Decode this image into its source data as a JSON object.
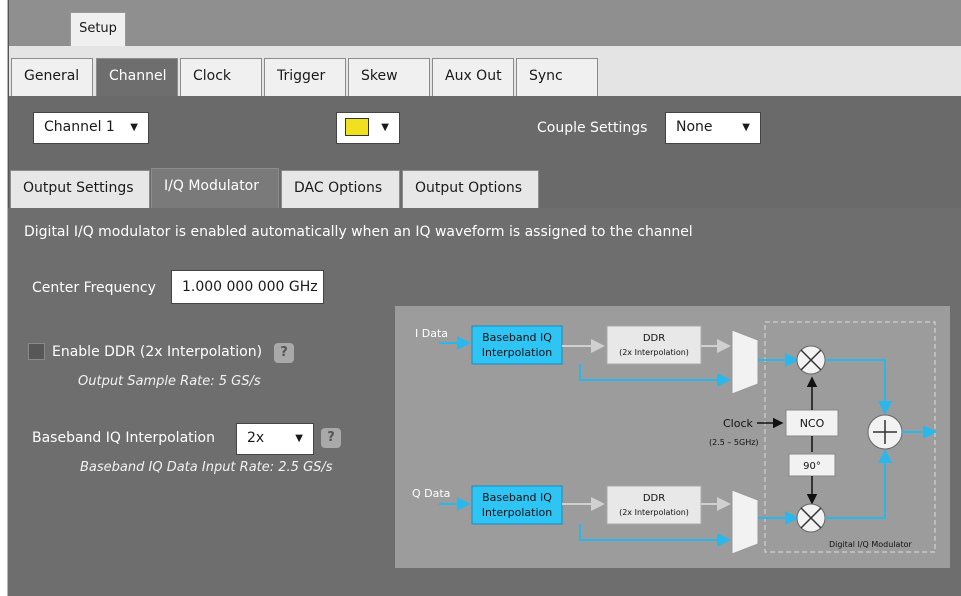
{
  "setup_tab": "Setup",
  "tabs": [
    "General",
    "Channel",
    "Clock",
    "Trigger",
    "Skew",
    "Aux Out",
    "Sync"
  ],
  "active_tab": "Channel",
  "channel_select": "Channel 1",
  "color_swatch": "#f0e020",
  "couple_label": "Couple Settings",
  "couple_value": "None",
  "subtabs": [
    "Output Settings",
    "I/Q Modulator",
    "DAC Options",
    "Output Options"
  ],
  "active_subtab": "I/Q Modulator",
  "info_text": "Digital I/Q modulator is enabled automatically when an IQ waveform is assigned to the channel",
  "center_freq_label": "Center Frequency",
  "center_freq_value": "1.000 000 000  GHz",
  "ddr_label": "Enable DDR (2x Interpolation)",
  "ddr_checked": false,
  "output_rate": "Output Sample Rate: 5 GS/s",
  "interp_label": "Baseband IQ Interpolation",
  "interp_value": "2x",
  "baseband_rate": "Baseband IQ Data Input Rate: 2.5 GS/s",
  "help_icon": "?",
  "diagram": {
    "i_data": "I Data",
    "q_data": "Q Data",
    "bb_line1": "Baseband IQ",
    "bb_line2": "Interpolation",
    "ddr": "DDR",
    "ddr_sub": "(2x Interpolation)",
    "clock": "Clock",
    "clock_range": "(2.5 – 5GHz)",
    "nco": "NCO",
    "phase": "90°",
    "block_title": "Digital I/Q Modulator"
  }
}
